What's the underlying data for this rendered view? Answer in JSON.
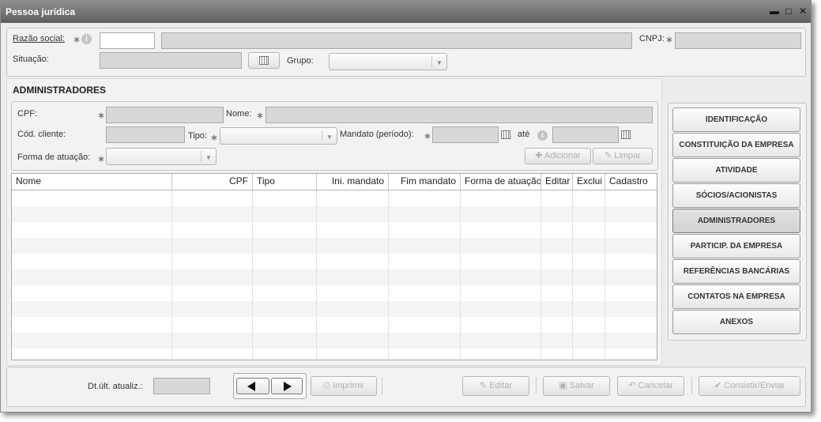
{
  "window": {
    "title": "Pessoa jurídica",
    "controls": [
      "minimize-icon",
      "maximize-icon",
      "close-icon"
    ]
  },
  "top": {
    "razao_social_label": "Razão social:",
    "cnpj_label": "CNPJ:",
    "situacao_label": "Situação:",
    "grupo_label": "Grupo:",
    "required_mark": "∗",
    "info_mark": "i"
  },
  "admin": {
    "section_title": "ADMINISTRADORES",
    "cpf_label": "CPF:",
    "nome_label": "Nome:",
    "cod_cliente_label": "Cód. cliente:",
    "tipo_label": "Tipo:",
    "mandato_label": "Mandato (período):",
    "ate_label": "até",
    "forma_label": "Forma de atuação:",
    "add_button": "Adicionar",
    "clear_button": "Limpar"
  },
  "grid": {
    "columns": [
      "Nome",
      "CPF",
      "Tipo",
      "Ini. mandato",
      "Fim mandato",
      "Forma de atuação",
      "Editar",
      "Exclui",
      "Cadastro"
    ],
    "rows": []
  },
  "tabs": [
    {
      "label": "IDENTIFICAÇÃO",
      "active": false
    },
    {
      "label": "CONSTITUIÇÃO DA EMPRESA",
      "active": false
    },
    {
      "label": "ATIVIDADE",
      "active": false
    },
    {
      "label": "SÓCIOS/ACIONISTAS",
      "active": false
    },
    {
      "label": "ADMINISTRADORES",
      "active": true
    },
    {
      "label": "PARTICIP. DA EMPRESA",
      "active": false
    },
    {
      "label": "REFERÊNCIAS BANCÁRIAS",
      "active": false
    },
    {
      "label": "CONTATOS NA EMPRESA",
      "active": false
    },
    {
      "label": "ANEXOS",
      "active": false
    }
  ],
  "footer": {
    "dt_label": "Dt.últ. atualiz.:",
    "print_button": "Imprimir",
    "edit_button": "Editar",
    "save_button": "Salvar",
    "cancel_button": "Cancelar",
    "submit_button": "Consistir/Enviar"
  }
}
